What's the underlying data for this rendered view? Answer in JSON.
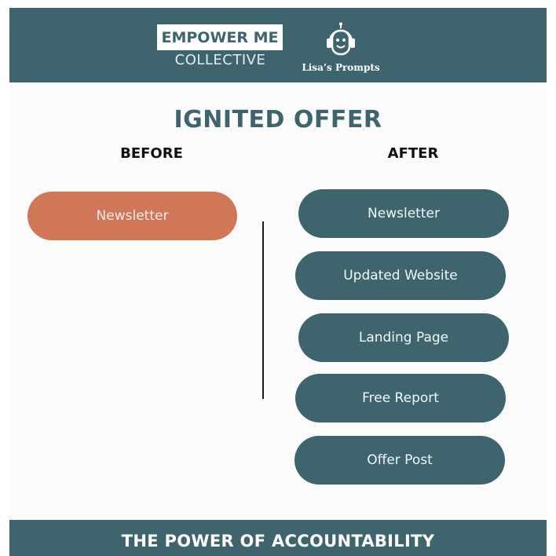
{
  "header": {
    "brand_top": "EMPOWER ME",
    "brand_bottom": "COLLECTIVE",
    "logo_icon": "robot-headset-icon",
    "logo_text": "Lisa’s Prompts"
  },
  "title": "IGNITED OFFER",
  "columns": {
    "before": {
      "heading": "BEFORE",
      "items": [
        "Newsletter"
      ]
    },
    "after": {
      "heading": "AFTER",
      "items": [
        "Newsletter",
        "Updated Website",
        "Landing Page",
        "Free Report",
        "Offer Post"
      ]
    }
  },
  "footer": {
    "text": "THE POWER OF ACCOUNTABILITY"
  },
  "colors": {
    "teal": "#3e646e",
    "orange": "#d07758",
    "white": "#ffffff"
  }
}
